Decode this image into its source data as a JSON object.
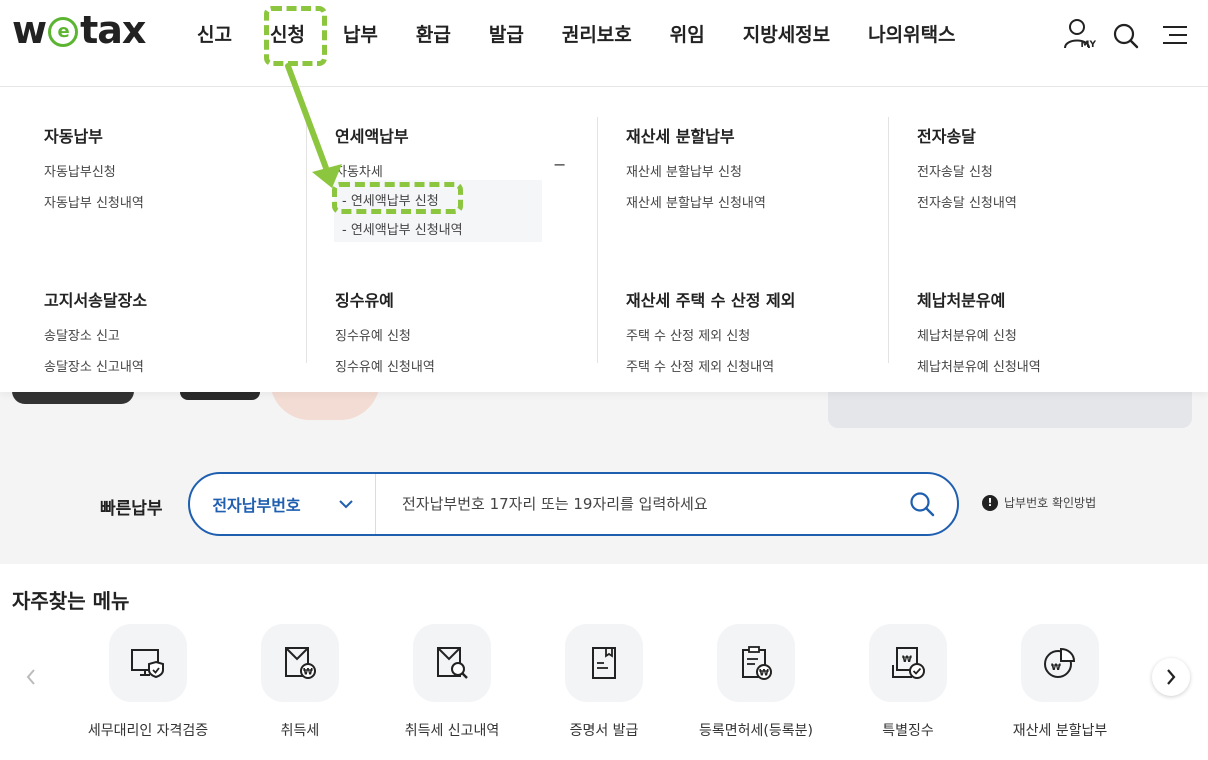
{
  "logo": {
    "text_before": "w",
    "text_e": "e",
    "text_after": "tax"
  },
  "gnb": [
    "신고",
    "신청",
    "납부",
    "환급",
    "발급",
    "권리보호",
    "위임",
    "지방세정보",
    "나의위택스"
  ],
  "header_icons": {
    "my_badge": "MY"
  },
  "mega_menu": {
    "columns": [
      {
        "title": "자동납부",
        "links": [
          "자동납부신청",
          "자동납부 신청내역"
        ]
      },
      {
        "title": "연세액납부",
        "links": [
          "자동차세"
        ],
        "toggle": "−",
        "submenu": [
          "- 연세액납부 신청",
          "- 연세액납부 신청내역"
        ]
      },
      {
        "title": "재산세 분할납부",
        "links": [
          "재산세 분할납부 신청",
          "재산세 분할납부 신청내역"
        ]
      },
      {
        "title": "전자송달",
        "links": [
          "전자송달 신청",
          "전자송달 신청내역"
        ]
      },
      {
        "title": "고지서송달장소",
        "links": [
          "송달장소 신고",
          "송달장소 신고내역"
        ]
      },
      {
        "title": "징수유예",
        "links": [
          "징수유예 신청",
          "징수유예 신청내역"
        ]
      },
      {
        "title": "재산세 주택 수 산정 제외",
        "links": [
          "주택 수 산정 제외 신청",
          "주택 수 산정 제외 신청내역"
        ]
      },
      {
        "title": "체납처분유예",
        "links": [
          "체납처분유예 신청",
          "체납처분유예 신청내역"
        ]
      }
    ]
  },
  "quick_pay": {
    "label": "빠른납부",
    "select_value": "전자납부번호",
    "placeholder": "전자납부번호 17자리 또는 19자리를 입력하세요",
    "help": "납부번호 확인방법"
  },
  "frequent": {
    "title": "자주찾는 메뉴",
    "items": [
      {
        "label": "세무대리인 자격검증",
        "icon": "monitor-shield-icon"
      },
      {
        "label": "취득세",
        "icon": "document-won-icon"
      },
      {
        "label": "취득세 신고내역",
        "icon": "document-search-icon"
      },
      {
        "label": "증명서 발급",
        "icon": "certificate-icon"
      },
      {
        "label": "등록면허세(등록분)",
        "icon": "clipboard-won-icon"
      },
      {
        "label": "특별징수",
        "icon": "document-check-icon"
      },
      {
        "label": "재산세 분할납부",
        "icon": "pie-chart-won-icon"
      }
    ]
  },
  "colors": {
    "accent_green": "#8cc63f",
    "brand_blue": "#1f5fb0",
    "logo_green": "#5cb531"
  }
}
